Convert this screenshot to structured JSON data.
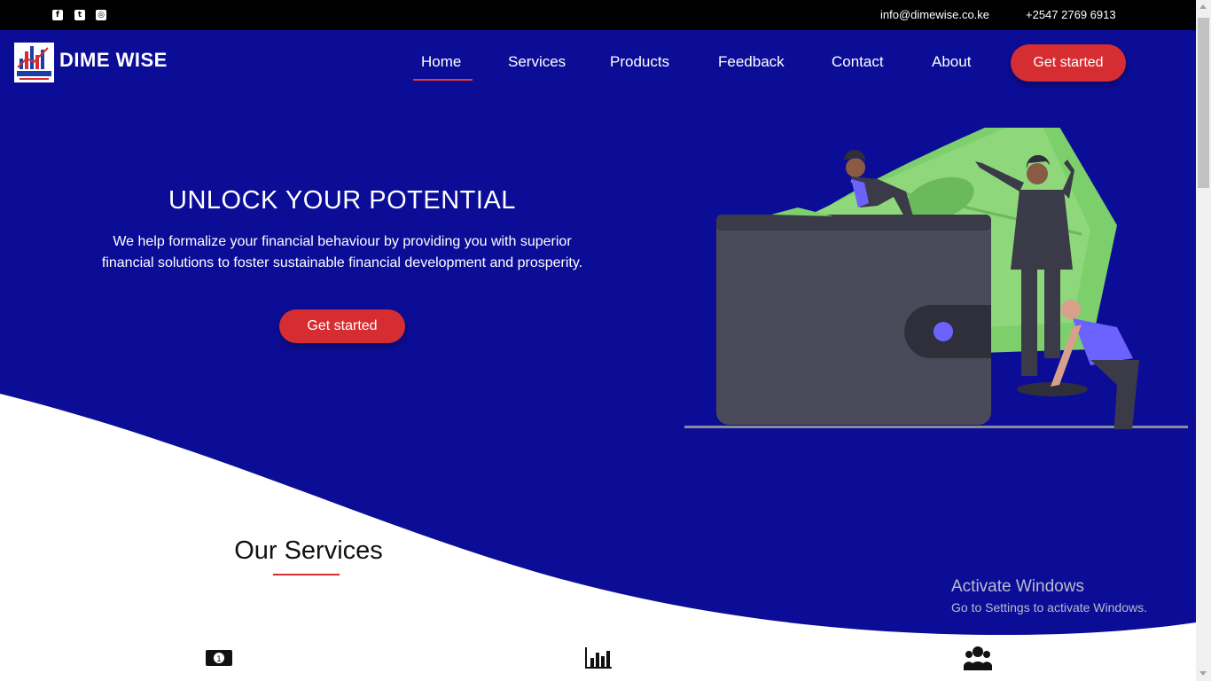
{
  "topbar": {
    "social": [
      {
        "icon": "facebook-icon",
        "glyph": "f"
      },
      {
        "icon": "twitter-icon",
        "glyph": "t"
      },
      {
        "icon": "instagram-icon",
        "glyph": "◎"
      }
    ],
    "email": "info@dimewise.co.ke",
    "phone": "+2547 2769 6913"
  },
  "header": {
    "brand": "DIME WISE",
    "nav": [
      "Home",
      "Services",
      "Products",
      "Feedback",
      "Contact",
      "About"
    ],
    "active_nav": "Home",
    "cta": "Get started"
  },
  "hero": {
    "title": "UNLOCK YOUR POTENTIAL",
    "subtitle": "We help formalize your financial behaviour by providing you with superior financial solutions to foster sustainable financial development and prosperity.",
    "cta": "Get started"
  },
  "services": {
    "title": "Our Services",
    "icons": [
      "money-bill-icon",
      "bar-chart-icon",
      "users-icon"
    ]
  },
  "watermark": {
    "line1": "Activate Windows",
    "line2": "Go to Settings to activate Windows."
  },
  "colors": {
    "hero_bg": "#0c0d97",
    "accent": "#d62d32",
    "topbar": "#000000"
  }
}
